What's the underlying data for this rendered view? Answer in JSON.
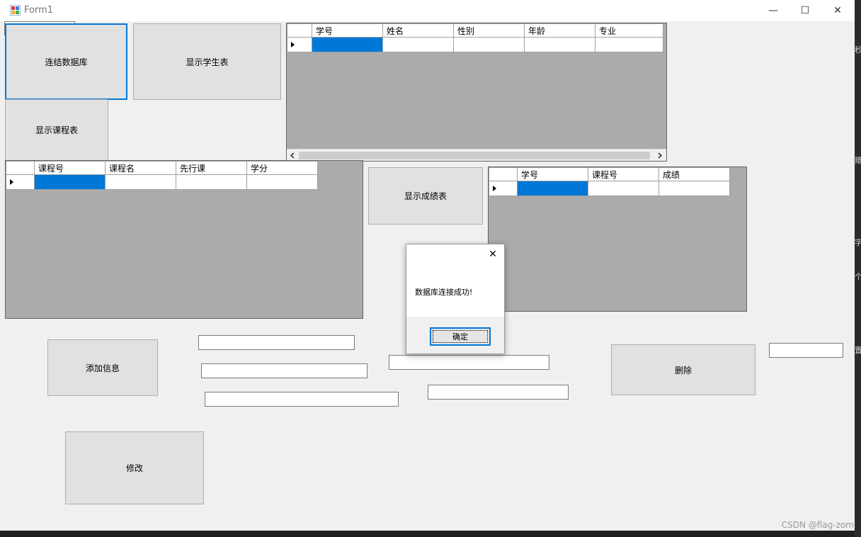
{
  "window": {
    "title": "Form1",
    "minimize": "—",
    "maximize": "☐",
    "close": "✕"
  },
  "buttons": {
    "connect_db": "连结数据库",
    "show_students": "显示学生表",
    "show_courses": "显示课程表",
    "show_grades": "显示成绩表",
    "add_info": "添加信息",
    "modify": "修改",
    "delete": "删除"
  },
  "student_grid": {
    "columns": [
      "学号",
      "姓名",
      "性别",
      "年龄",
      "专业"
    ]
  },
  "course_grid": {
    "columns": [
      "课程号",
      "课程名",
      "先行课",
      "学分"
    ]
  },
  "grade_grid": {
    "columns": [
      "学号",
      "课程号",
      "成绩"
    ]
  },
  "dialog": {
    "message": "数据库连接成功!",
    "ok": "确定",
    "close": "✕"
  },
  "watermark": "CSDN @flag-zom",
  "side_glyphs": [
    "秒",
    "赠",
    "字",
    "个",
    "置"
  ]
}
